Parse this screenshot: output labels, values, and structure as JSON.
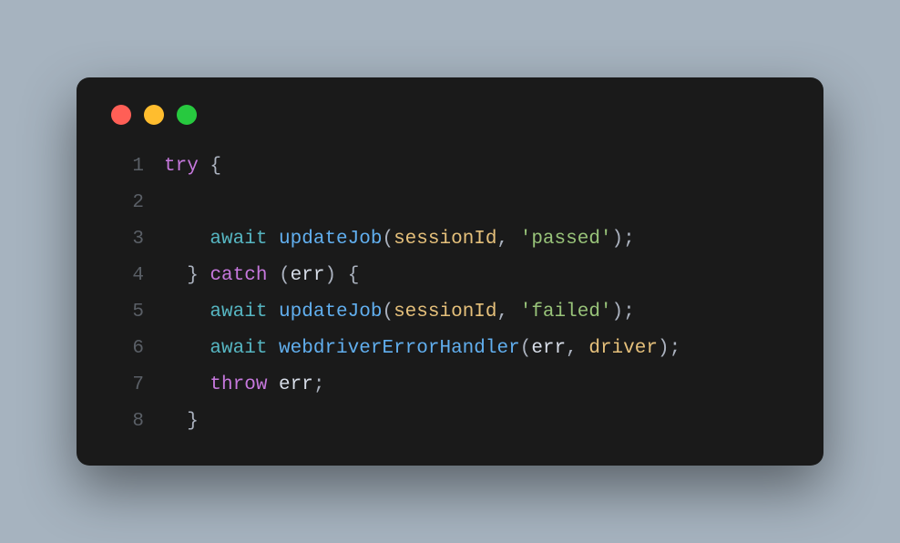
{
  "window": {
    "controls": {
      "red": "#ff5f56",
      "yellow": "#ffbd2e",
      "green": "#27c93f"
    }
  },
  "code": {
    "lines": [
      "1",
      "2",
      "3",
      "4",
      "5",
      "6",
      "7",
      "8"
    ],
    "tokens": {
      "try": "try",
      "obrace": " {",
      "await": "await",
      "updateJob": "updateJob",
      "sessionId": "sessionId",
      "passed": "'passed'",
      "failed": "'failed'",
      "catch": "catch",
      "err": "err",
      "webdriverErrorHandler": "webdriverErrorHandler",
      "driver": "driver",
      "throw": "throw",
      "cbrace": "}",
      "lp": "(",
      "rp": ")",
      "comma": ", ",
      "semi": ";",
      "ind1": "  ",
      "ind2": "    ",
      "sp": " "
    }
  }
}
